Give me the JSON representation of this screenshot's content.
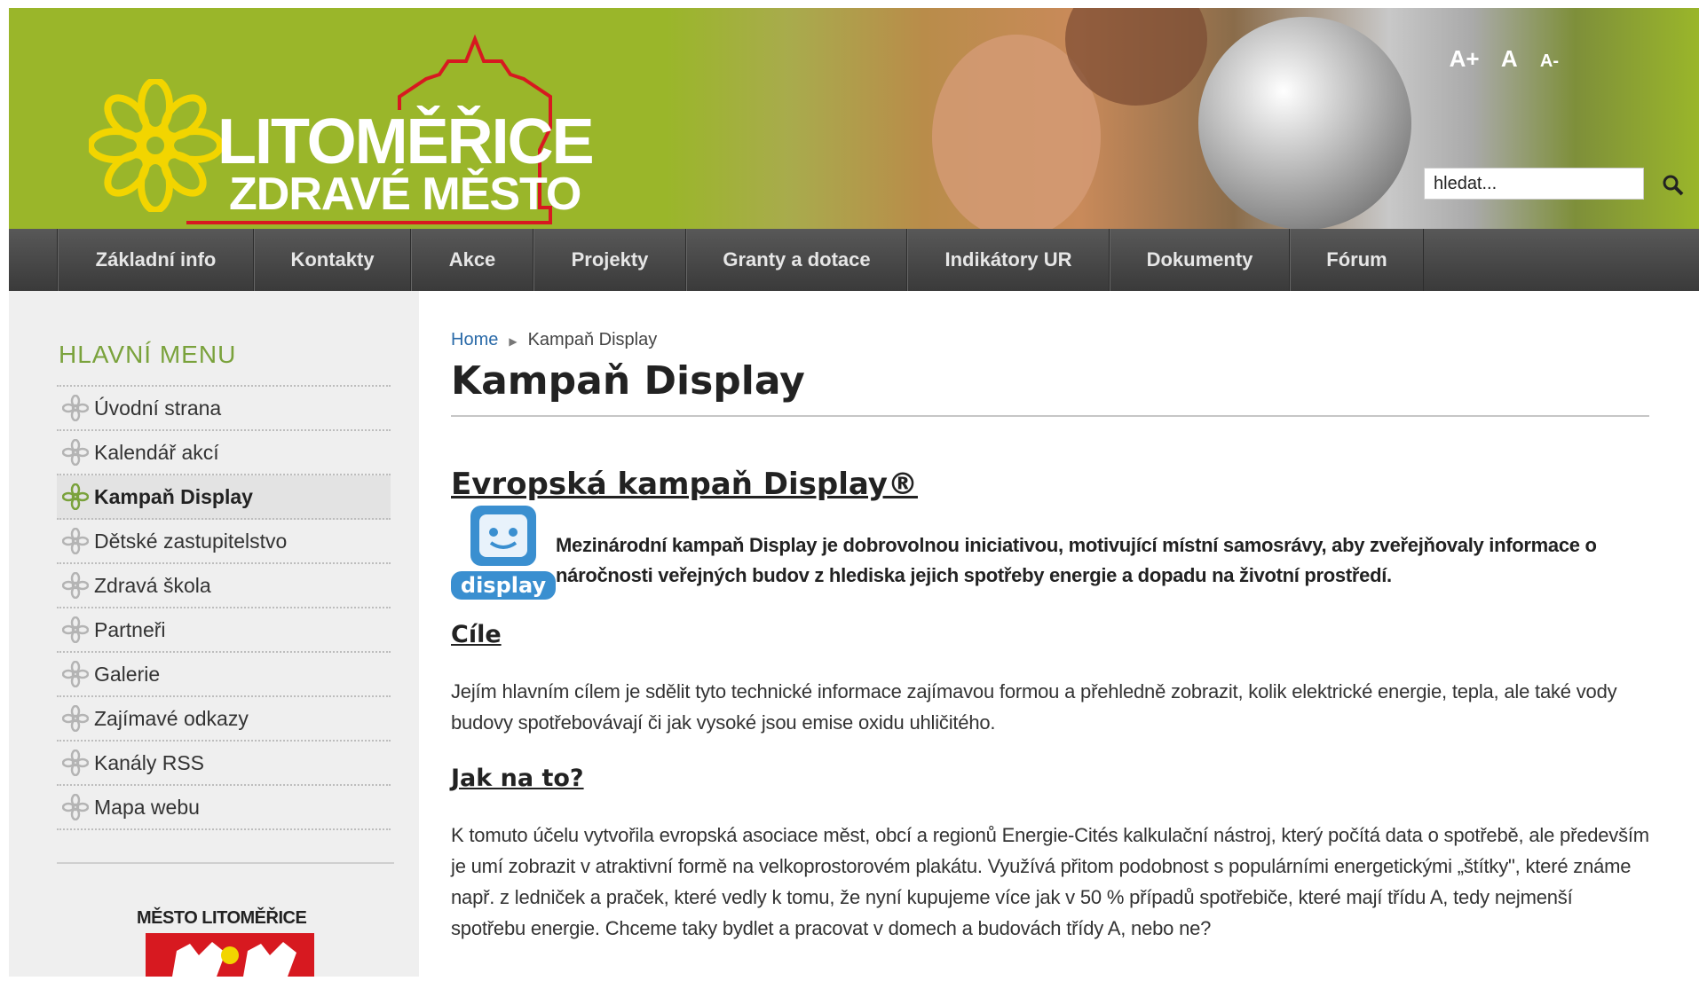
{
  "header": {
    "logo_title": "LITOMĚŘICE",
    "logo_subtitle": "ZDRAVÉ MĚSTO",
    "font_controls": [
      "A+",
      "A",
      "A-"
    ],
    "search_placeholder": "hledat..."
  },
  "nav": {
    "items": [
      "Základní info",
      "Kontakty",
      "Akce",
      "Projekty",
      "Granty a dotace",
      "Indikátory UR",
      "Dokumenty",
      "Fórum"
    ]
  },
  "sidebar": {
    "title": "HLAVNÍ MENU",
    "items": [
      "Úvodní strana",
      "Kalendář akcí",
      "Kampaň Display",
      "Dětské zastupitelstvo",
      "Zdravá škola",
      "Partneři",
      "Galerie",
      "Zajímavé odkazy",
      "Kanály RSS",
      "Mapa webu"
    ],
    "active_item": "Kampaň Display",
    "city_label": "MĚSTO LITOMĚŘICE"
  },
  "breadcrumb": {
    "home": "Home",
    "current": "Kampaň Display"
  },
  "main": {
    "title": "Kampaň Display",
    "section1_heading": "Evropská kampaň Display®",
    "logo_text": "display",
    "intro": "Mezinárodní kampaň Display je dobrovolnou iniciativou, motivující místní samosrávy, aby zveřejňovaly informace o náročnosti veřejných budov z hlediska jejich spotřeby energie a dopadu na životní prostředí.",
    "section2_heading": "Cíle",
    "section2_text": "Jejím hlavním cílem je sdělit tyto technické informace zajímavou formou a přehledně zobrazit, kolik elektrické energie, tepla, ale také vody budovy spotřebovávají či jak vysoké jsou emise oxidu uhličitého.",
    "section3_heading": "Jak na to?",
    "section3_text": " K tomuto účelu vytvořila evropská asociace měst, obcí a regionů Energie-Cités kalkulační nástroj, který počítá data o spotřebě, ale především je umí zobrazit v atraktivní formě na velkoprostorovém plakátu. Využívá přitom podobnost s populárními energetickými „štítky\", které známe např. z ledniček a praček, které vedly k tomu, že nyní kupujeme více jak v 50 % případů spotřebiče, které mají třídu A, tedy nejmenší spotřebu energie. Chceme taky bydlet a pracovat v domech a budovách třídy A, nebo ne?"
  },
  "colors": {
    "header_green": "#9ab62a",
    "nav_dark": "#454545",
    "sidebar_title_green": "#7aa23c",
    "link_blue": "#2a6aa8",
    "logo_red": "#d71920",
    "logo_yellow": "#f2d500"
  }
}
